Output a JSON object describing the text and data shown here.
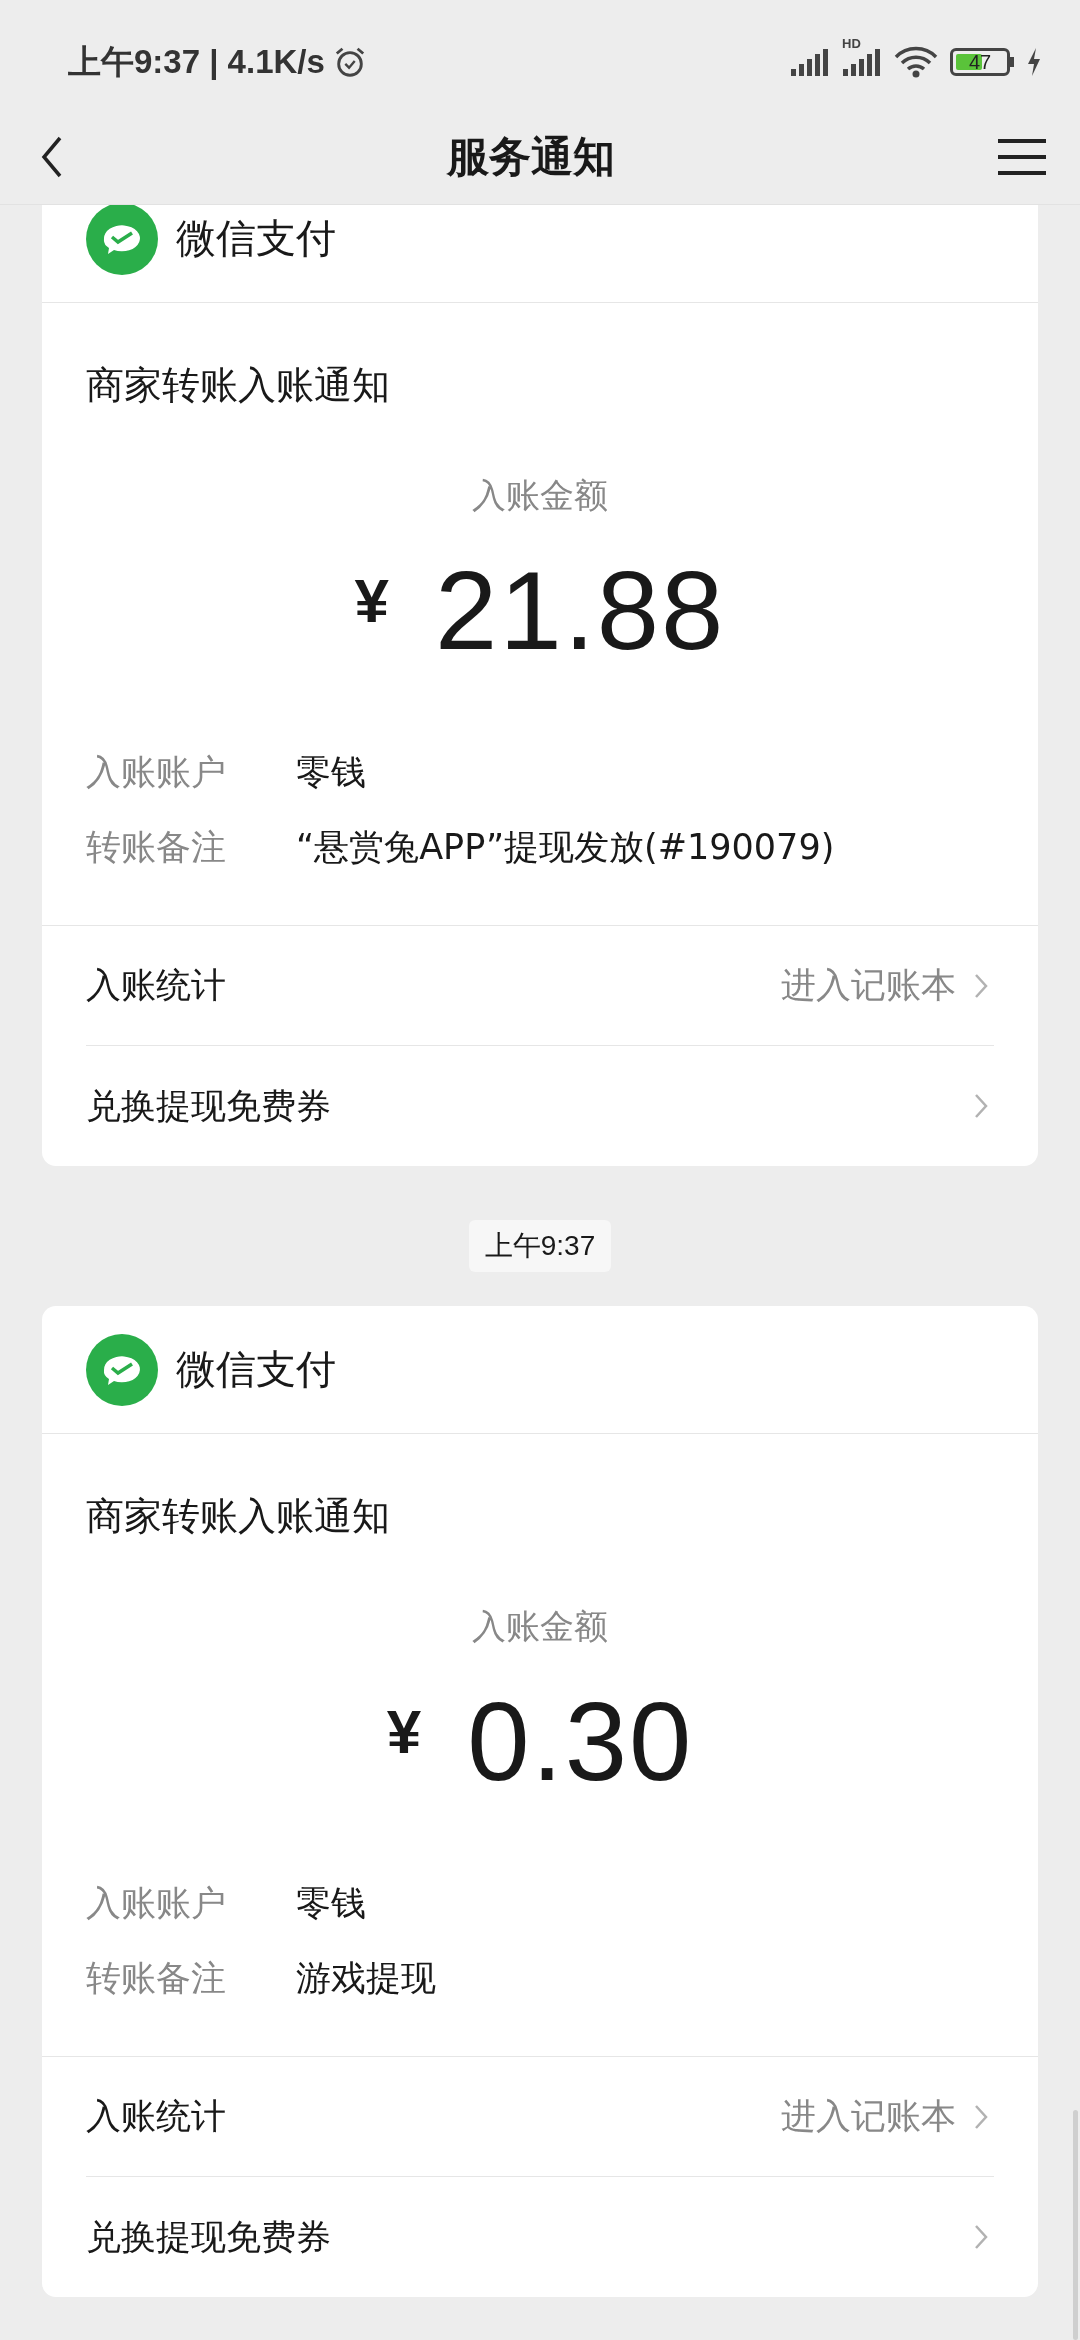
{
  "status_bar": {
    "time": "上午9:37 | 4.1K/s",
    "network_label": "HD",
    "battery": "47"
  },
  "nav": {
    "title": "服务通知"
  },
  "cards": [
    {
      "sender": "微信支付",
      "title": "商家转账入账通知",
      "amount_label": "入账金额",
      "currency": "¥",
      "amount": "21.88",
      "fields": [
        {
          "label": "入账账户",
          "value": "零钱"
        },
        {
          "label": "转账备注",
          "value": "“悬赏兔APP”提现发放(#190079)"
        }
      ],
      "links": [
        {
          "label": "入账统计",
          "value": "进入记账本"
        },
        {
          "label": "兑换提现免费券"
        }
      ]
    },
    {
      "timestamp": "上午9:37",
      "sender": "微信支付",
      "title": "商家转账入账通知",
      "amount_label": "入账金额",
      "currency": "¥",
      "amount": "0.30",
      "fields": [
        {
          "label": "入账账户",
          "value": "零钱"
        },
        {
          "label": "转账备注",
          "value": "游戏提现"
        }
      ],
      "links": [
        {
          "label": "入账统计",
          "value": "进入记账本"
        },
        {
          "label": "兑换提现免费券"
        }
      ]
    }
  ]
}
